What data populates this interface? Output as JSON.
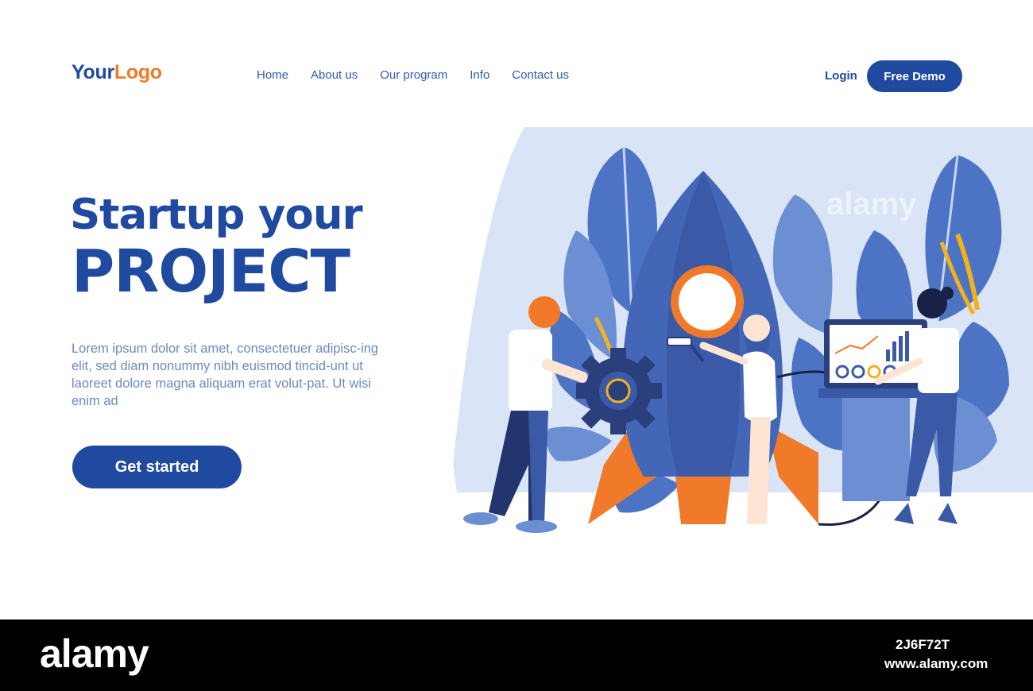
{
  "header": {
    "logo": {
      "part1": "Your",
      "part2": "Logo"
    },
    "nav": [
      "Home",
      "About us",
      "Our program",
      "Info",
      "Contact us"
    ],
    "login_label": "Login",
    "demo_label": "Free Demo"
  },
  "hero": {
    "title_line1": "Startup your",
    "title_line2": "PROJECT",
    "body": "Lorem ipsum dolor sit amet, consectetuer adipisc-ing elit, sed diam nonummy nibh euismod tincid-unt ut laoreet dolore magna aliquam erat volut-pat. Ut wisi enim ad",
    "cta_label": "Get started"
  },
  "illustration": {
    "watermark": "alamy"
  },
  "footer": {
    "brand": "alamy",
    "image_code": "2J6F72T",
    "url": "www.alamy.com"
  },
  "colors": {
    "primary": "#1f4aa0",
    "accent": "#f07a2a",
    "text_muted": "#6e88bf",
    "panel": "#d9e4f6"
  }
}
